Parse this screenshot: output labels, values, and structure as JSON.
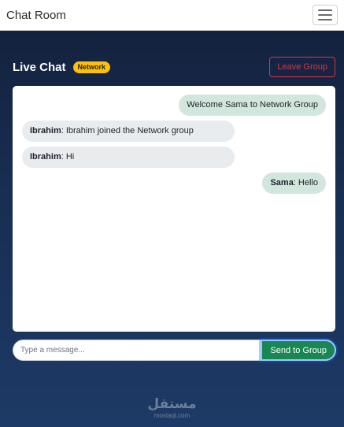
{
  "navbar": {
    "brand": "Chat Room",
    "toggle_icon": "hamburger-menu-icon"
  },
  "header": {
    "title": "Live Chat",
    "badge": "Network",
    "leave_label": "Leave Group"
  },
  "messages": [
    {
      "side": "right",
      "sender": "",
      "text": "Welcome Sama to Network Group"
    },
    {
      "side": "left",
      "sender": "Ibrahim",
      "text": ": Ibrahim joined the Network group"
    },
    {
      "side": "left",
      "sender": "Ibrahim",
      "text": ": Hi"
    },
    {
      "side": "right",
      "sender": "Sama",
      "text": ": Hello"
    }
  ],
  "composer": {
    "placeholder": "Type a message...",
    "send_label": "Send to Group"
  },
  "watermark": {
    "logo": "مستقل",
    "site": "mostaql.com"
  },
  "colors": {
    "badge": "#ffc107",
    "leave": "#dc3545",
    "send": "#198754",
    "incoming": "#e9ecef",
    "outgoing": "#d1e7dd"
  }
}
